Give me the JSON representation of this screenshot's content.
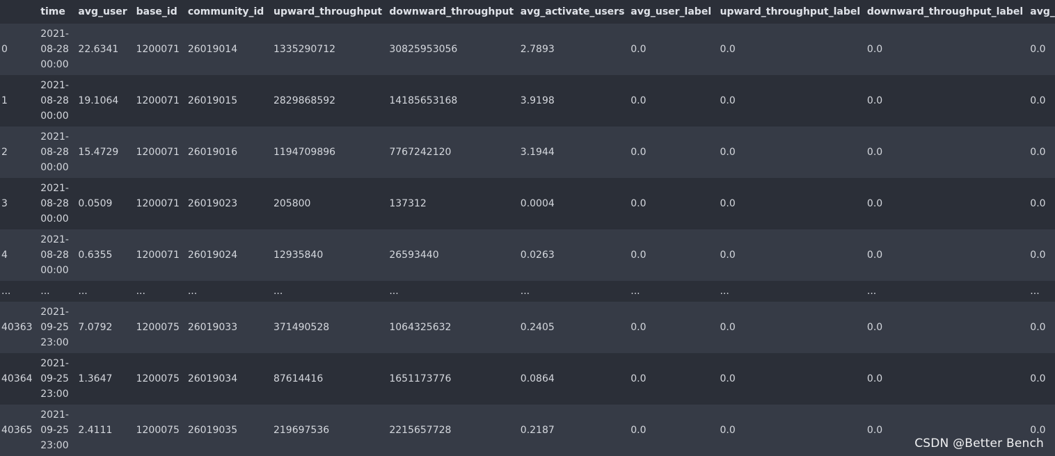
{
  "columns": [
    "",
    "time",
    "avg_user",
    "base_id",
    "community_id",
    "upward_throughput",
    "downward_throughput",
    "avg_activate_users",
    "avg_user_label",
    "upward_throughput_label",
    "downward_throughput_label",
    "avg_"
  ],
  "rows": [
    {
      "kind": "data",
      "index": "0",
      "time": [
        "2021-",
        "08-28",
        "00:00"
      ],
      "avg_user": "22.6341",
      "base_id": "1200071",
      "community_id": "26019014",
      "upward_throughput": "1335290712",
      "downward_throughput": "30825953056",
      "avg_activate_users": "2.7893",
      "avg_user_label": "0.0",
      "upward_throughput_label": "0.0",
      "downward_throughput_label": "0.0",
      "avg_": "0.0"
    },
    {
      "kind": "data",
      "index": "1",
      "time": [
        "2021-",
        "08-28",
        "00:00"
      ],
      "avg_user": "19.1064",
      "base_id": "1200071",
      "community_id": "26019015",
      "upward_throughput": "2829868592",
      "downward_throughput": "14185653168",
      "avg_activate_users": "3.9198",
      "avg_user_label": "0.0",
      "upward_throughput_label": "0.0",
      "downward_throughput_label": "0.0",
      "avg_": "0.0"
    },
    {
      "kind": "data",
      "index": "2",
      "time": [
        "2021-",
        "08-28",
        "00:00"
      ],
      "avg_user": "15.4729",
      "base_id": "1200071",
      "community_id": "26019016",
      "upward_throughput": "1194709896",
      "downward_throughput": "7767242120",
      "avg_activate_users": "3.1944",
      "avg_user_label": "0.0",
      "upward_throughput_label": "0.0",
      "downward_throughput_label": "0.0",
      "avg_": "0.0"
    },
    {
      "kind": "data",
      "index": "3",
      "time": [
        "2021-",
        "08-28",
        "00:00"
      ],
      "avg_user": "0.0509",
      "base_id": "1200071",
      "community_id": "26019023",
      "upward_throughput": "205800",
      "downward_throughput": "137312",
      "avg_activate_users": "0.0004",
      "avg_user_label": "0.0",
      "upward_throughput_label": "0.0",
      "downward_throughput_label": "0.0",
      "avg_": "0.0"
    },
    {
      "kind": "data",
      "index": "4",
      "time": [
        "2021-",
        "08-28",
        "00:00"
      ],
      "avg_user": "0.6355",
      "base_id": "1200071",
      "community_id": "26019024",
      "upward_throughput": "12935840",
      "downward_throughput": "26593440",
      "avg_activate_users": "0.0263",
      "avg_user_label": "0.0",
      "upward_throughput_label": "0.0",
      "downward_throughput_label": "0.0",
      "avg_": "0.0"
    },
    {
      "kind": "ellipsis",
      "index": "...",
      "time": [
        "..."
      ],
      "avg_user": "...",
      "base_id": "...",
      "community_id": "...",
      "upward_throughput": "...",
      "downward_throughput": "...",
      "avg_activate_users": "...",
      "avg_user_label": "...",
      "upward_throughput_label": "...",
      "downward_throughput_label": "...",
      "avg_": "..."
    },
    {
      "kind": "data",
      "index": "40363",
      "time": [
        "2021-",
        "09-25",
        "23:00"
      ],
      "avg_user": "7.0792",
      "base_id": "1200075",
      "community_id": "26019033",
      "upward_throughput": "371490528",
      "downward_throughput": "1064325632",
      "avg_activate_users": "0.2405",
      "avg_user_label": "0.0",
      "upward_throughput_label": "0.0",
      "downward_throughput_label": "0.0",
      "avg_": "0.0"
    },
    {
      "kind": "data",
      "index": "40364",
      "time": [
        "2021-",
        "09-25",
        "23:00"
      ],
      "avg_user": "1.3647",
      "base_id": "1200075",
      "community_id": "26019034",
      "upward_throughput": "87614416",
      "downward_throughput": "1651173776",
      "avg_activate_users": "0.0864",
      "avg_user_label": "0.0",
      "upward_throughput_label": "0.0",
      "downward_throughput_label": "0.0",
      "avg_": "0.0"
    },
    {
      "kind": "data",
      "index": "40365",
      "time": [
        "2021-",
        "09-25",
        "23:00"
      ],
      "avg_user": "2.4111",
      "base_id": "1200075",
      "community_id": "26019035",
      "upward_throughput": "219697536",
      "downward_throughput": "2215657728",
      "avg_activate_users": "0.2187",
      "avg_user_label": "0.0",
      "upward_throughput_label": "0.0",
      "downward_throughput_label": "0.0",
      "avg_": "0.0"
    }
  ],
  "watermark": "CSDN @Better Bench",
  "colors": {
    "background": "#2b2f38",
    "row_alt": "#363b46",
    "text": "#d5d8de",
    "header_text": "#dfe2e8"
  }
}
